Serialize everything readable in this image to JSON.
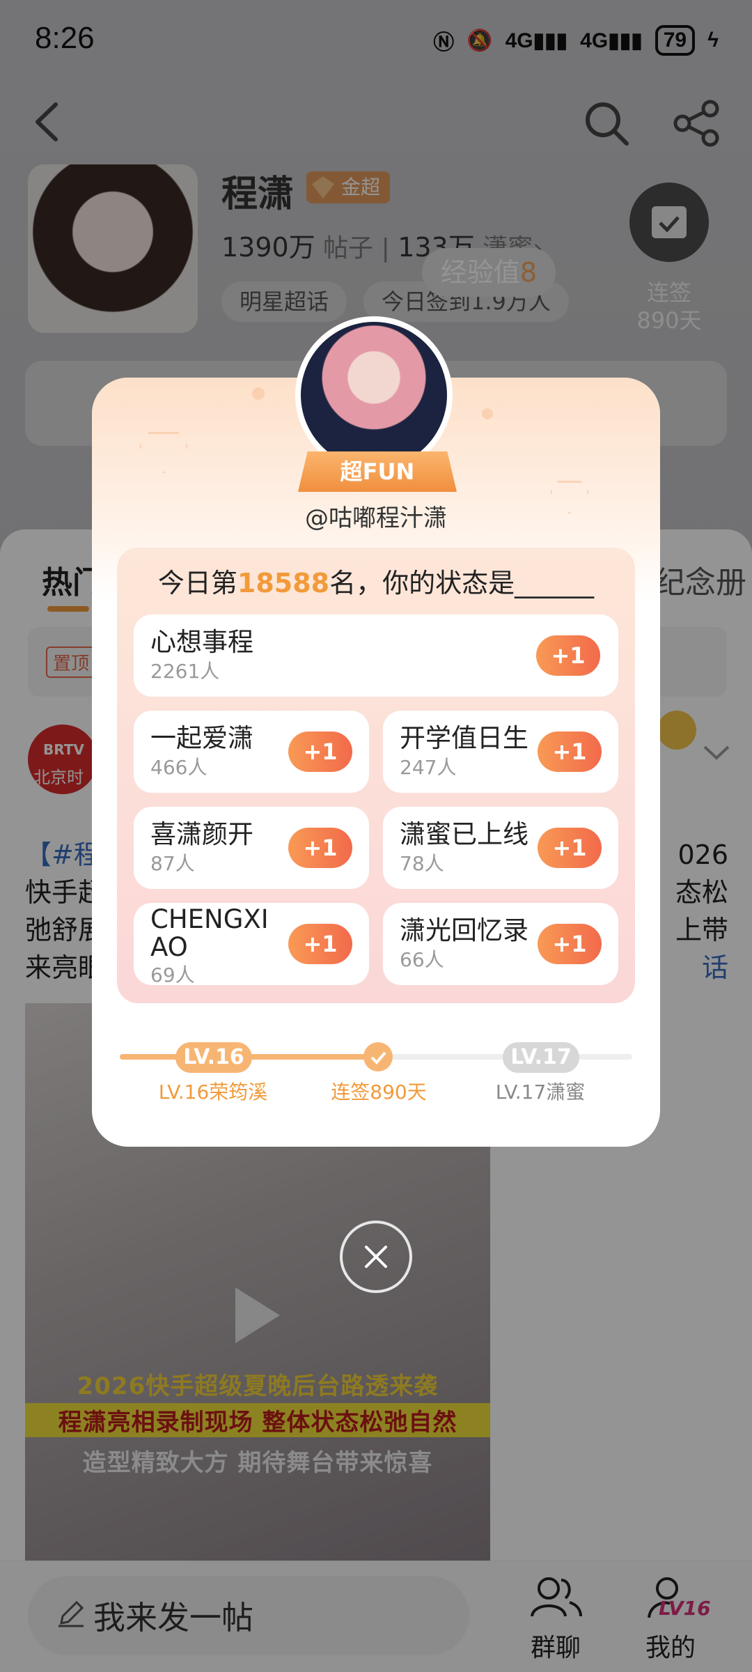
{
  "status_bar": {
    "time": "8:26",
    "network_1": "4G",
    "network_2": "4G",
    "battery": "79"
  },
  "profile": {
    "name": "程潇",
    "badge": "金超",
    "posts_count": "1390万",
    "posts_label": "帖子",
    "fans_count": "133万",
    "fans_label": "潇蜜",
    "tag_1": "明星超话",
    "tag_2": "今日签到1.9万人",
    "checkin_label": "连签",
    "checkin_days": "890天",
    "exp_label": "经验值",
    "exp_value": "8"
  },
  "tabs": {
    "hot": "热门",
    "memorial": "纪念册"
  },
  "pinned_tag": "置顶",
  "post": {
    "source_badge": "BRTV",
    "source_name": "北京时",
    "text_hashtag": "【#程",
    "text_line2": "快手超",
    "text_line3": "弛舒展",
    "text_line4": "来亮眼",
    "text_right1": "026",
    "text_right2": "态松",
    "text_right3": "上带",
    "text_right4": "话"
  },
  "video": {
    "caption_1": "2026快手超级夏晚后台路透来袭",
    "caption_2": "程潇亮相录制现场 整体状态松弛自然",
    "caption_3": "造型精致大方 期待舞台带来惊喜"
  },
  "bottom_bar": {
    "compose_placeholder": "我来发一帖",
    "group_chat": "群聊",
    "mine": "我的",
    "mine_level": "LV16"
  },
  "modal": {
    "ribbon": "超FUN",
    "handle": "@咕嘟程汁潇",
    "title_prefix": "今日第",
    "rank": "18588",
    "title_suffix": "名，你的状态是______",
    "plus_label": "+1",
    "options": [
      {
        "label": "心想事程",
        "count": "2261人"
      },
      {
        "label": "一起爱潇",
        "count": "466人"
      },
      {
        "label": "开学值日生",
        "count": "247人"
      },
      {
        "label": "喜潇颜开",
        "count": "87人"
      },
      {
        "label": "潇蜜已上线",
        "count": "78人"
      },
      {
        "label": "CHENGXI\nAO",
        "count": "69人"
      },
      {
        "label": "潇光回忆录",
        "count": "66人"
      }
    ],
    "level_current": "LV.16",
    "level_next": "LV.17",
    "level_current_name": "LV.16荣筠溪",
    "streak": "连签890天",
    "level_next_name": "LV.17潇蜜"
  },
  "colors": {
    "accent": "#f29a3a",
    "plus_gradient_start": "#f89a55",
    "plus_gradient_end": "#f26a4b",
    "link": "#3a6bbf"
  }
}
